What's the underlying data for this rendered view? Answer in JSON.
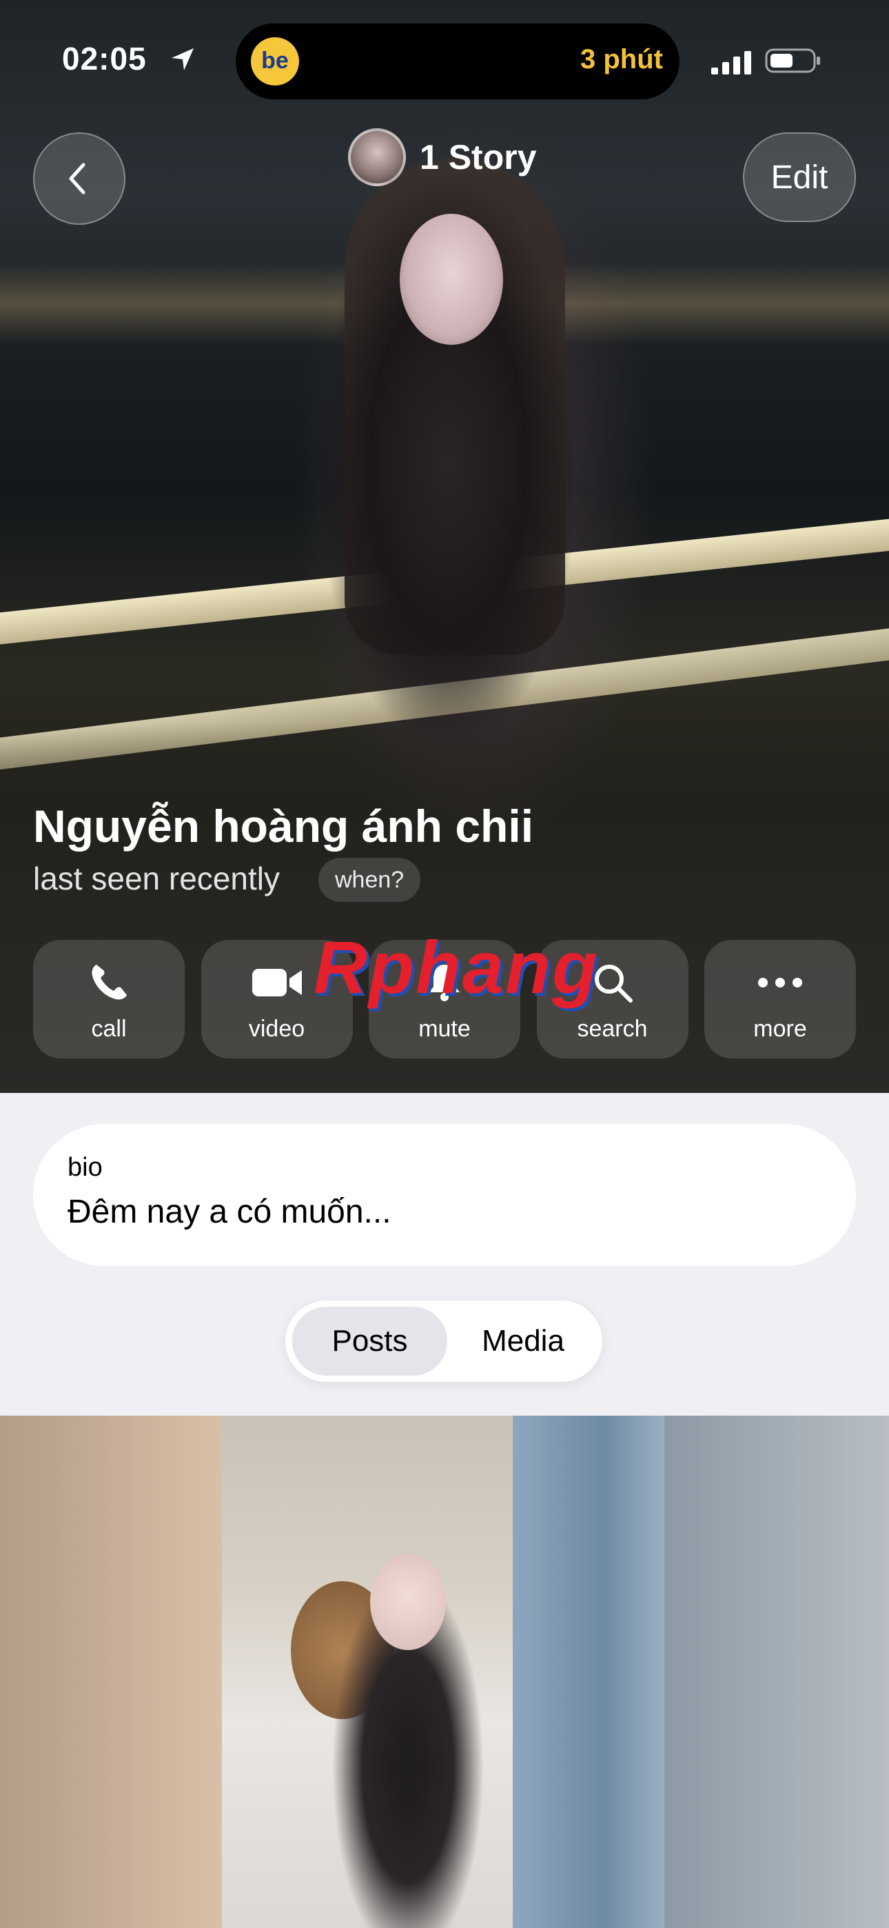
{
  "status_bar": {
    "time": "02:05",
    "island_app": "be",
    "island_text": "3 phút"
  },
  "header": {
    "story_label": "1 Story",
    "edit_label": "Edit"
  },
  "profile": {
    "name": "Nguyễn hoàng ánh chii",
    "status": "last seen recently",
    "when_label": "when?"
  },
  "actions": [
    {
      "label": "call",
      "icon": "phone-icon"
    },
    {
      "label": "video",
      "icon": "video-camera-icon"
    },
    {
      "label": "mute",
      "icon": "bell-icon"
    },
    {
      "label": "search",
      "icon": "search-icon"
    },
    {
      "label": "more",
      "icon": "more-dots-icon"
    }
  ],
  "watermark": "Rphang",
  "bio": {
    "label": "bio",
    "text": "Đêm nay a có muốn..."
  },
  "tabs": [
    {
      "label": "Posts",
      "selected": true
    },
    {
      "label": "Media",
      "selected": false
    }
  ],
  "colors": {
    "island_accent": "#f4c23a",
    "background": "#efeff4"
  }
}
